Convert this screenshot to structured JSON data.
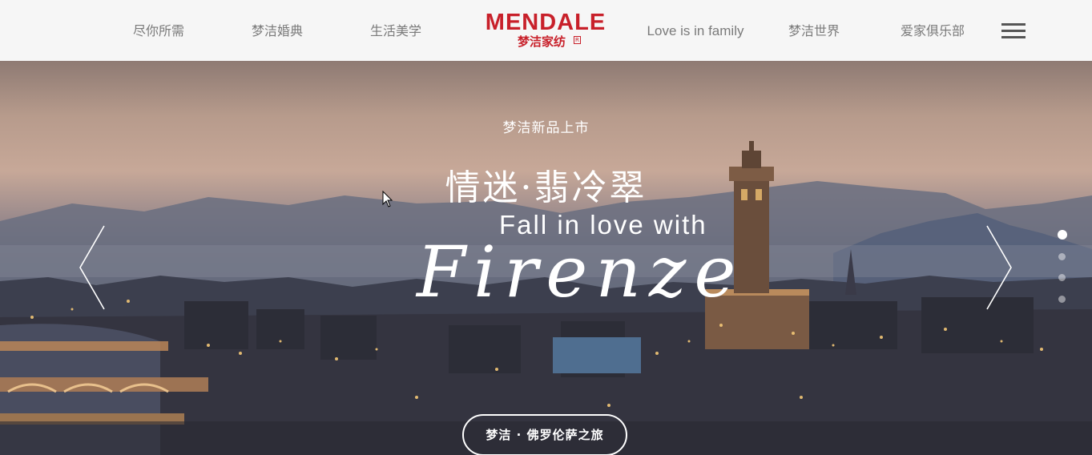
{
  "header": {
    "nav": [
      {
        "label": "尽你所需"
      },
      {
        "label": "梦洁婚典"
      },
      {
        "label": "生活美学"
      },
      {
        "label": "Love is in family"
      },
      {
        "label": "梦洁世界"
      },
      {
        "label": "爱家俱乐部"
      }
    ],
    "logo": {
      "brand_en": "MENDALE",
      "brand_cn": "梦洁家纺",
      "mark": "R"
    },
    "menu_icon": "hamburger-icon"
  },
  "hero": {
    "subtitle": "梦洁新品上市",
    "title": "情迷·翡冷翠",
    "tagline": "Fall in love with",
    "script_word": "Firenze",
    "cta_label": "梦洁 · 佛罗伦萨之旅",
    "prev_icon": "chevron-left-icon",
    "next_icon": "chevron-right-icon",
    "slides": [
      {
        "active": true
      },
      {
        "active": false
      },
      {
        "active": false
      },
      {
        "active": false
      }
    ]
  },
  "colors": {
    "brand_red": "#c8202a",
    "nav_text": "#7a7a7a",
    "header_bg": "#f6f6f6"
  }
}
